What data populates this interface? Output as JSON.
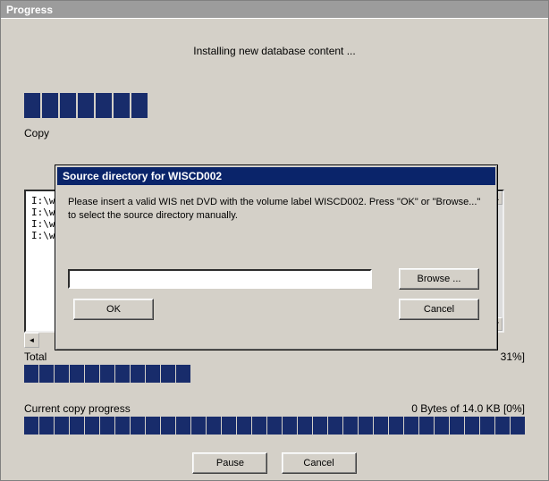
{
  "window": {
    "title": "Progress"
  },
  "status_heading": "Installing new database content ...",
  "top_progress_blocks": 7,
  "copy_label": "Copy",
  "file_list": [
    "I:\\w",
    "I:\\w",
    "I:\\w",
    "I:\\w"
  ],
  "total": {
    "label_left": "Total",
    "label_right": "31%]",
    "blocks": 11
  },
  "current": {
    "label_left": "Current copy progress",
    "label_right": "0 Bytes of 14.0 KB [0%]",
    "blocks": 33
  },
  "bottom_buttons": {
    "pause": "Pause",
    "cancel": "Cancel"
  },
  "dialog": {
    "title": "Source directory for WISCD002",
    "message": "Please insert a valid WIS net DVD with the volume label WISCD002. Press \"OK\" or \"Browse...\" to select the source directory manually.",
    "input_value": "",
    "browse_label": "Browse ...",
    "ok_label": "OK",
    "cancel_label": "Cancel"
  },
  "scroll": {
    "up": "▲",
    "down": "▼",
    "left": "◄"
  }
}
